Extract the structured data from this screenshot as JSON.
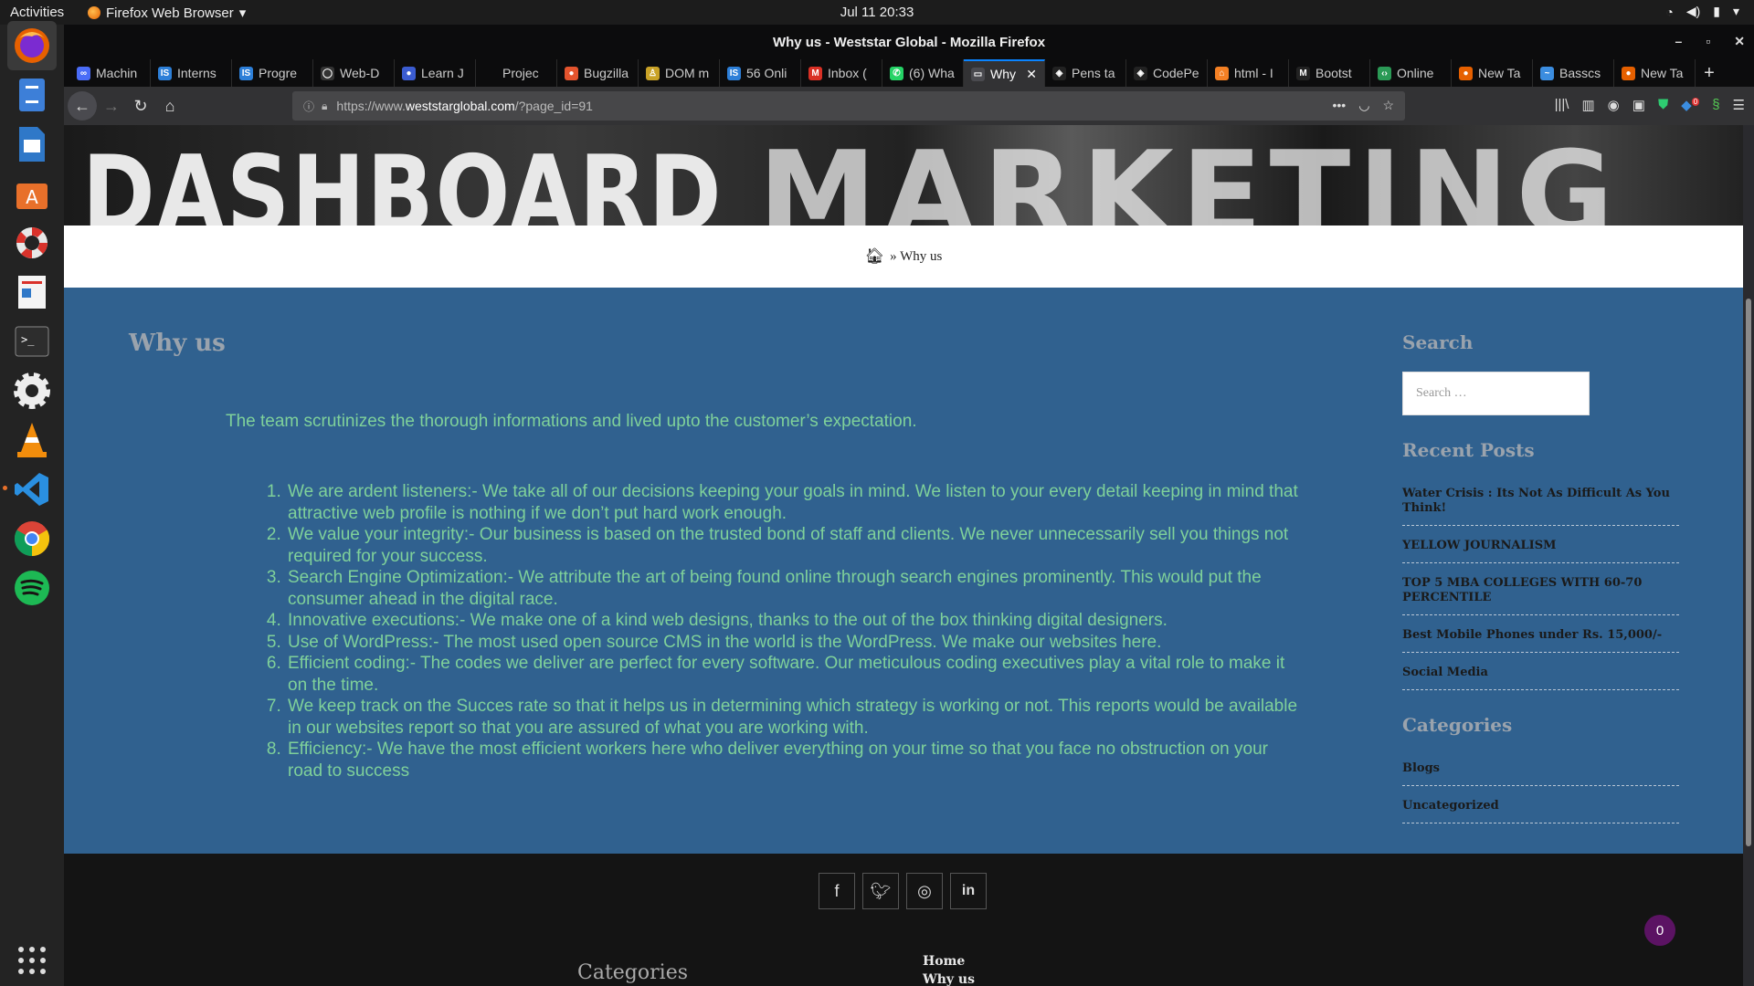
{
  "topbar": {
    "activities": "Activities",
    "app_menu": "Firefox Web Browser",
    "clock": "Jul 11  20:33"
  },
  "window": {
    "title": "Why us - Weststar Global - Mozilla Firefox"
  },
  "tabs": [
    {
      "label": "Machin",
      "icon": "∞",
      "color": "#4a6cf7"
    },
    {
      "label": "Interns",
      "icon": "IS",
      "color": "#2d7fd8"
    },
    {
      "label": "Progre",
      "icon": "IS",
      "color": "#2d7fd8"
    },
    {
      "label": "Web-D",
      "icon": "◯",
      "color": "#333"
    },
    {
      "label": "Learn J",
      "icon": "●",
      "color": "#3b5cd1"
    },
    {
      "label": "Projec",
      "icon": "",
      "color": "#0c0c0d"
    },
    {
      "label": "Bugzilla",
      "icon": "●",
      "color": "#e4542e"
    },
    {
      "label": "DOM m",
      "icon": "♙",
      "color": "#c9a227"
    },
    {
      "label": "56 Onli",
      "icon": "IS",
      "color": "#2d7fd8"
    },
    {
      "label": "Inbox (",
      "icon": "M",
      "color": "#d93025"
    },
    {
      "label": "(6) Wha",
      "icon": "✆",
      "color": "#25d366"
    },
    {
      "label": "Why",
      "icon": "▭",
      "color": "#4a4a4f",
      "active": true
    },
    {
      "label": "Pens ta",
      "icon": "◈",
      "color": "#222"
    },
    {
      "label": "CodePe",
      "icon": "◈",
      "color": "#222"
    },
    {
      "label": "html - I",
      "icon": "⌂",
      "color": "#f48024"
    },
    {
      "label": "Bootst",
      "icon": "M",
      "color": "#222"
    },
    {
      "label": "Online",
      "icon": "‹›",
      "color": "#2b9a56"
    },
    {
      "label": "New Ta",
      "icon": "●",
      "color": "#e66000"
    },
    {
      "label": "Basscs",
      "icon": "~",
      "color": "#3b8de0"
    },
    {
      "label": "New Ta",
      "icon": "●",
      "color": "#e66000"
    }
  ],
  "url": {
    "prefix": "https://www.",
    "host": "weststarglobal.com",
    "path": "/?page_id=91"
  },
  "hero": {
    "word1": "DASHBOARD",
    "word2": "MARKETING"
  },
  "breadcrumb": {
    "text": "» Why us"
  },
  "main": {
    "title": "Why us",
    "lead": "The team scrutinizes the thorough informations and lived upto the customer’s expectation.",
    "items": [
      "We are ardent listeners:- We take all of our decisions keeping your goals in mind. We listen to your every detail keeping in mind that attractive web profile is nothing if we don’t put hard work enough.",
      "We value your integrity:- Our business is based on the trusted bond of staff and clients. We never unnecessarily sell you things not required for your success.",
      "Search Engine Optimization:- We attribute the art of being found online through search engines prominently. This would put the consumer ahead in the digital race.",
      "Innovative executions:- We make one of a kind web designs, thanks to the out of the box thinking digital designers.",
      "Use of WordPress:- The most used open source CMS in the world is the WordPress. We make our websites here.",
      "Efficient coding:- The codes we deliver are perfect for every software. Our meticulous coding executives play a vital role to make it on the time.",
      "We keep track on the Succes rate so that it helps us in determining which strategy is working or not. This reports would be available in our websites report so that you are assured of what you are working with.",
      "Efficiency:- We have the most efficient workers here who deliver everything on your time so that you face no obstruction on your road to success"
    ]
  },
  "sidebar": {
    "search_heading": "Search",
    "search_placeholder": "Search …",
    "recent_heading": "Recent Posts",
    "recent_posts": [
      "Water Crisis : Its Not As Difficult As You Think!",
      "YELLOW JOURNALISM",
      "TOP 5 MBA COLLEGES WITH 60-70 PERCENTILE",
      "Best Mobile Phones under Rs. 15,000/-",
      "Social Media"
    ],
    "categories_heading": "Categories",
    "categories": [
      "Blogs",
      "Uncategorized"
    ]
  },
  "footer": {
    "categories_heading": "Categories",
    "links": [
      "Home",
      "Why us"
    ]
  },
  "chat_badge": "0",
  "ext_badge": "0"
}
